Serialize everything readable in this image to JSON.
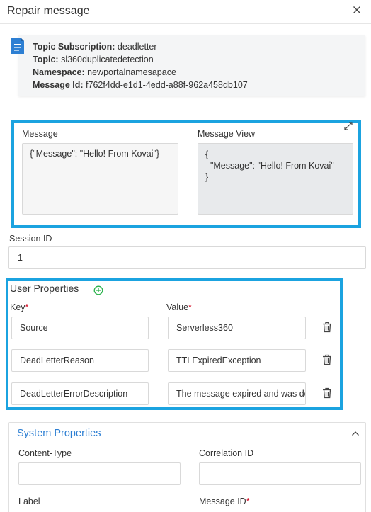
{
  "header": {
    "title": "Repair message"
  },
  "info": {
    "topic_subscription_label": "Topic Subscription:",
    "topic_subscription_value": "deadletter",
    "topic_label": "Topic:",
    "topic_value": "sl360duplicatedetection",
    "namespace_label": "Namespace:",
    "namespace_value": "newportalnamesapace",
    "message_id_label": "Message Id:",
    "message_id_value": "f762f4dd-e1d1-4edd-a88f-962a458db107"
  },
  "message": {
    "label": "Message",
    "value": "{\"Message\": \"Hello! From Kovai\"}",
    "view_label": "Message View",
    "view_value": "{\n  \"Message\": \"Hello! From Kovai\"\n}"
  },
  "session": {
    "label": "Session ID",
    "value": "1"
  },
  "user_properties": {
    "heading": "User Properties",
    "key_label": "Key",
    "value_label": "Value",
    "required_mark": "*",
    "rows": [
      {
        "key": "Source",
        "value": "Serverless360"
      },
      {
        "key": "DeadLetterReason",
        "value": "TTLExpiredException"
      },
      {
        "key": "DeadLetterErrorDescription",
        "value": "The message expired and was dead lettered."
      }
    ]
  },
  "system_properties": {
    "heading": "System Properties",
    "content_type_label": "Content-Type",
    "correlation_id_label": "Correlation ID",
    "label_label": "Label",
    "message_id_label": "Message ID",
    "required_mark": "*"
  },
  "colors": {
    "highlight": "#1ba3e0",
    "accent_blue": "#2d7fd3",
    "required": "#d0021b",
    "add_green": "#2bb24c"
  }
}
